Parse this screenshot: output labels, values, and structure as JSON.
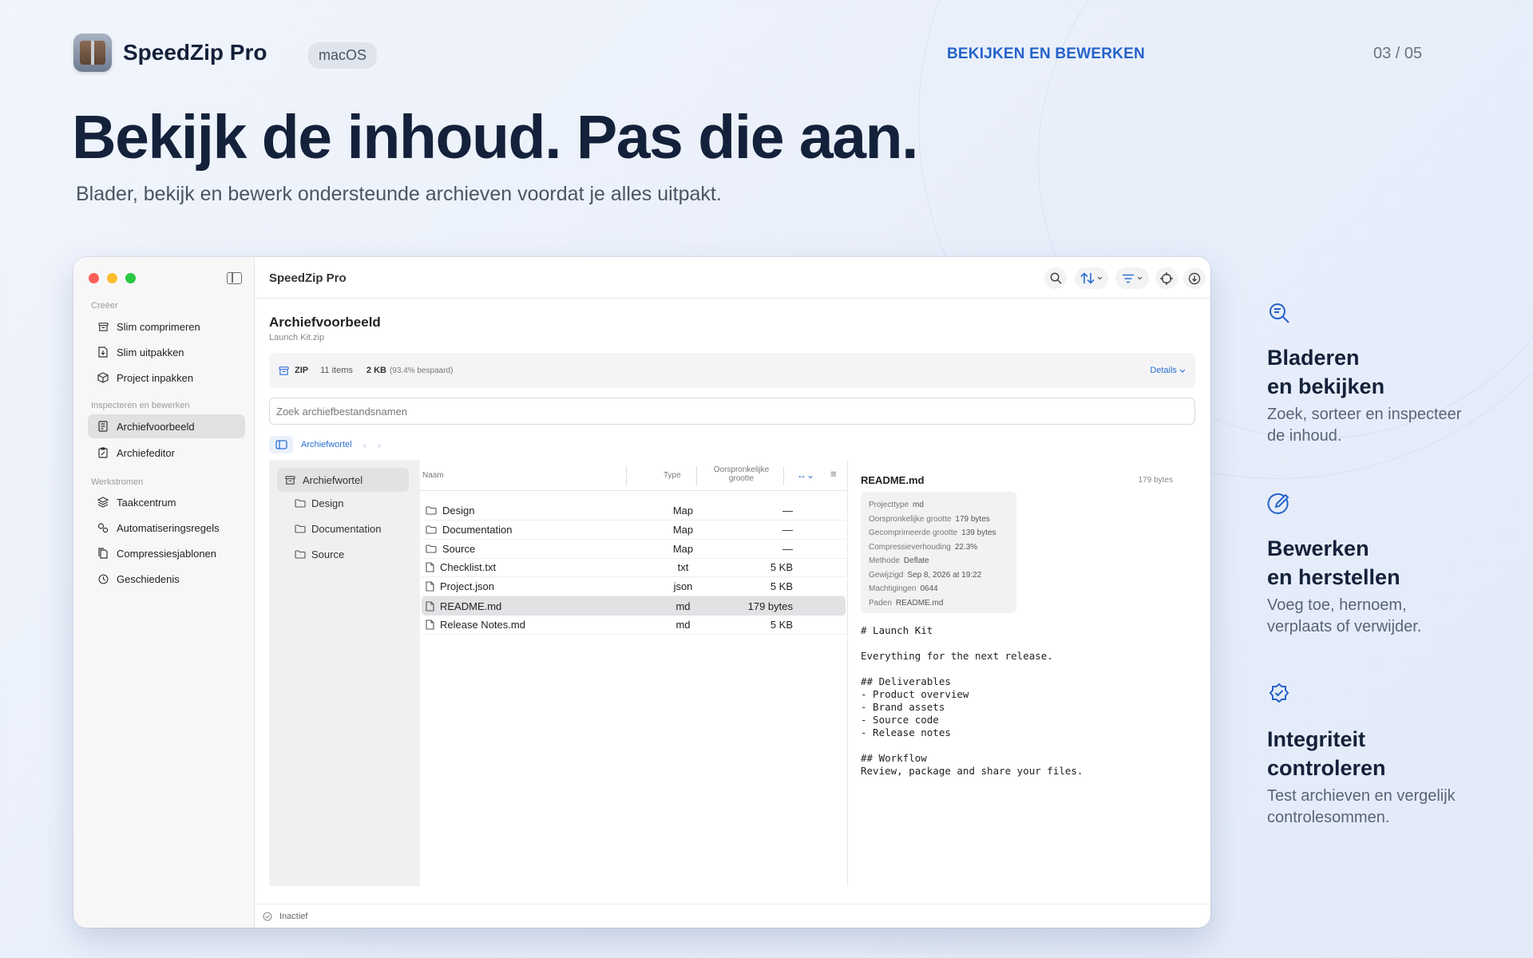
{
  "brand": {
    "name": "SpeedZip Pro",
    "platform": "macOS"
  },
  "section_tag": "BEKIJKEN EN BEWERKEN",
  "page_counter": "03 / 05",
  "headline": "Bekijk de inhoud. Pas die aan.",
  "subheadline": "Blader, bekijk en bewerk ondersteunde archieven voordat je alles uitpakt.",
  "window": {
    "title": "SpeedZip Pro",
    "sidebar": {
      "sections": [
        {
          "label": "Creëer",
          "items": [
            {
              "label": "Slim comprimeren",
              "icon": "archive-box-icon"
            },
            {
              "label": "Slim uitpakken",
              "icon": "document-unzip-icon"
            },
            {
              "label": "Project inpakken",
              "icon": "package-cube-icon"
            }
          ]
        },
        {
          "label": "Inspecteren en bewerken",
          "items": [
            {
              "label": "Archiefvoorbeeld",
              "icon": "document-preview-icon",
              "selected": true
            },
            {
              "label": "Archiefeditor",
              "icon": "clipboard-edit-icon"
            }
          ]
        },
        {
          "label": "Werkstromen",
          "items": [
            {
              "label": "Taakcentrum",
              "icon": "stack-icon"
            },
            {
              "label": "Automatiseringsregels",
              "icon": "gears-icon"
            },
            {
              "label": "Compressiesjablonen",
              "icon": "document-template-icon"
            },
            {
              "label": "Geschiedenis",
              "icon": "clock-icon"
            }
          ]
        }
      ]
    },
    "archive": {
      "title": "Archiefvoorbeeld",
      "file": "Launch Kit.zip"
    },
    "info": {
      "format": "ZIP",
      "items": "11 items",
      "size": "2 KB",
      "saved": "(93.4% bespaard)",
      "details_label": "Details"
    },
    "search_placeholder": "Zoek archiefbestandsnamen",
    "breadcrumb": "Archiefwortel",
    "tree": {
      "root": "Archiefwortel",
      "children": [
        "Design",
        "Documentation",
        "Source"
      ]
    },
    "columns": {
      "name": "Naam",
      "type": "Type",
      "size_line1": "Oorspronkelijke",
      "size_line2": "grootte"
    },
    "rows": [
      {
        "name": "Design",
        "type": "Map",
        "size": "—",
        "kind": "folder"
      },
      {
        "name": "Documentation",
        "type": "Map",
        "size": "—",
        "kind": "folder"
      },
      {
        "name": "Source",
        "type": "Map",
        "size": "—",
        "kind": "folder"
      },
      {
        "name": "Checklist.txt",
        "type": "txt",
        "size": "5 KB",
        "kind": "file"
      },
      {
        "name": "Project.json",
        "type": "json",
        "size": "5 KB",
        "kind": "file"
      },
      {
        "name": "README.md",
        "type": "md",
        "size": "179 bytes",
        "kind": "file",
        "selected": true
      },
      {
        "name": "Release Notes.md",
        "type": "md",
        "size": "5 KB",
        "kind": "file"
      }
    ],
    "preview": {
      "name": "README.md",
      "size": "179 bytes",
      "meta": [
        {
          "k": "Projecttype",
          "v": "md"
        },
        {
          "k": "Oorspronkelijke grootte",
          "v": "179 bytes"
        },
        {
          "k": "Gecomprimeerde grootte",
          "v": "139 bytes"
        },
        {
          "k": "Compressieverhouding",
          "v": "22.3%"
        },
        {
          "k": "Methode",
          "v": "Deflate"
        },
        {
          "k": "Gewijzigd",
          "v": "Sep 8, 2026 at 19:22"
        },
        {
          "k": "Machtigingen",
          "v": "0644"
        },
        {
          "k": "Paden",
          "v": "README.md"
        }
      ],
      "content": "# Launch Kit\n\nEverything for the next release.\n\n## Deliverables\n- Product overview\n- Brand assets\n- Source code\n- Release notes\n\n## Workflow\nReview, package and share your files."
    },
    "status": "Inactief"
  },
  "features": [
    {
      "title1": "Bladeren",
      "title2": "en bekijken",
      "desc": "Zoek, sorteer en inspecteer de inhoud.",
      "icon": "search-document-icon"
    },
    {
      "title1": "Bewerken",
      "title2": "en herstellen",
      "desc": "Voeg toe, hernoem, verplaats of verwijder.",
      "icon": "edit-pencil-circle-icon"
    },
    {
      "title1": "Integriteit",
      "title2": "controleren",
      "desc": "Test archieven en vergelijk controlesommen.",
      "icon": "verified-badge-icon"
    }
  ],
  "colors": {
    "accent": "#2563c9",
    "headline": "#14213a"
  }
}
